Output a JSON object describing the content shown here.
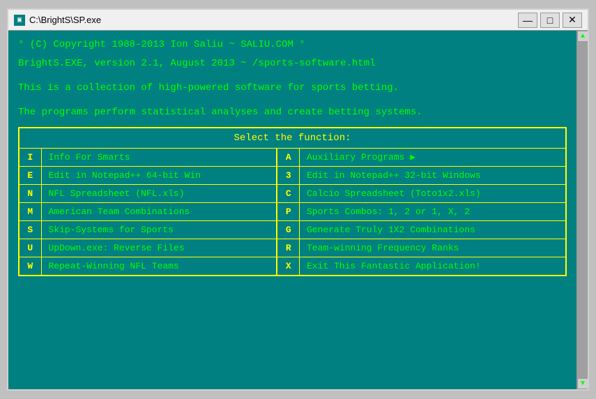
{
  "window": {
    "title": "C:\\BrightS\\SP.exe",
    "icon": "▣"
  },
  "titlebar": {
    "minimize": "—",
    "maximize": "□",
    "close": "✕"
  },
  "content": {
    "line1": "° (C) Copyright 1988-2013 Ion Saliu ~ SALIU.COM °",
    "line2": "BrightS.EXE, version 2.1, August 2013 ~ /sports-software.html",
    "line3": "",
    "line4": "This is a collection of high-powered software for sports betting.",
    "line5": "",
    "line6": "The programs perform statistical analyses and create betting systems."
  },
  "menu": {
    "header": "Select the function:",
    "rows": [
      {
        "key1": "I",
        "label1": "Info For Smarts",
        "key2": "A",
        "label2": "Auxiliary Programs",
        "arrow2": true
      },
      {
        "key1": "E",
        "label1": "Edit in Notepad++ 64-bit Win",
        "key2": "3",
        "label2": "Edit in Notepad++ 32-bit Windows",
        "arrow2": false
      },
      {
        "key1": "N",
        "label1": "NFL Spreadsheet (NFL.xls)",
        "key2": "C",
        "label2": "Calcio Spreadsheet (Toto1x2.xls)",
        "arrow2": false
      },
      {
        "key1": "M",
        "label1": "American Team Combinations",
        "key2": "P",
        "label2": "Sports Combos:  1, 2 or 1, X, 2",
        "arrow2": false
      },
      {
        "key1": "S",
        "label1": "Skip-Systems for Sports",
        "key2": "G",
        "label2": "Generate Truly 1X2 Combinations",
        "arrow2": false
      },
      {
        "key1": "U",
        "label1": "UpDown.exe: Reverse Files",
        "key2": "R",
        "label2": "Team-winning Frequency Ranks",
        "arrow2": false
      },
      {
        "key1": "W",
        "label1": "Repeat-Winning NFL Teams",
        "key2": "X",
        "label2": "Exit This Fantastic Application!",
        "arrow2": false
      }
    ]
  },
  "scrollbar": {
    "up": "▲",
    "down": "▼"
  }
}
